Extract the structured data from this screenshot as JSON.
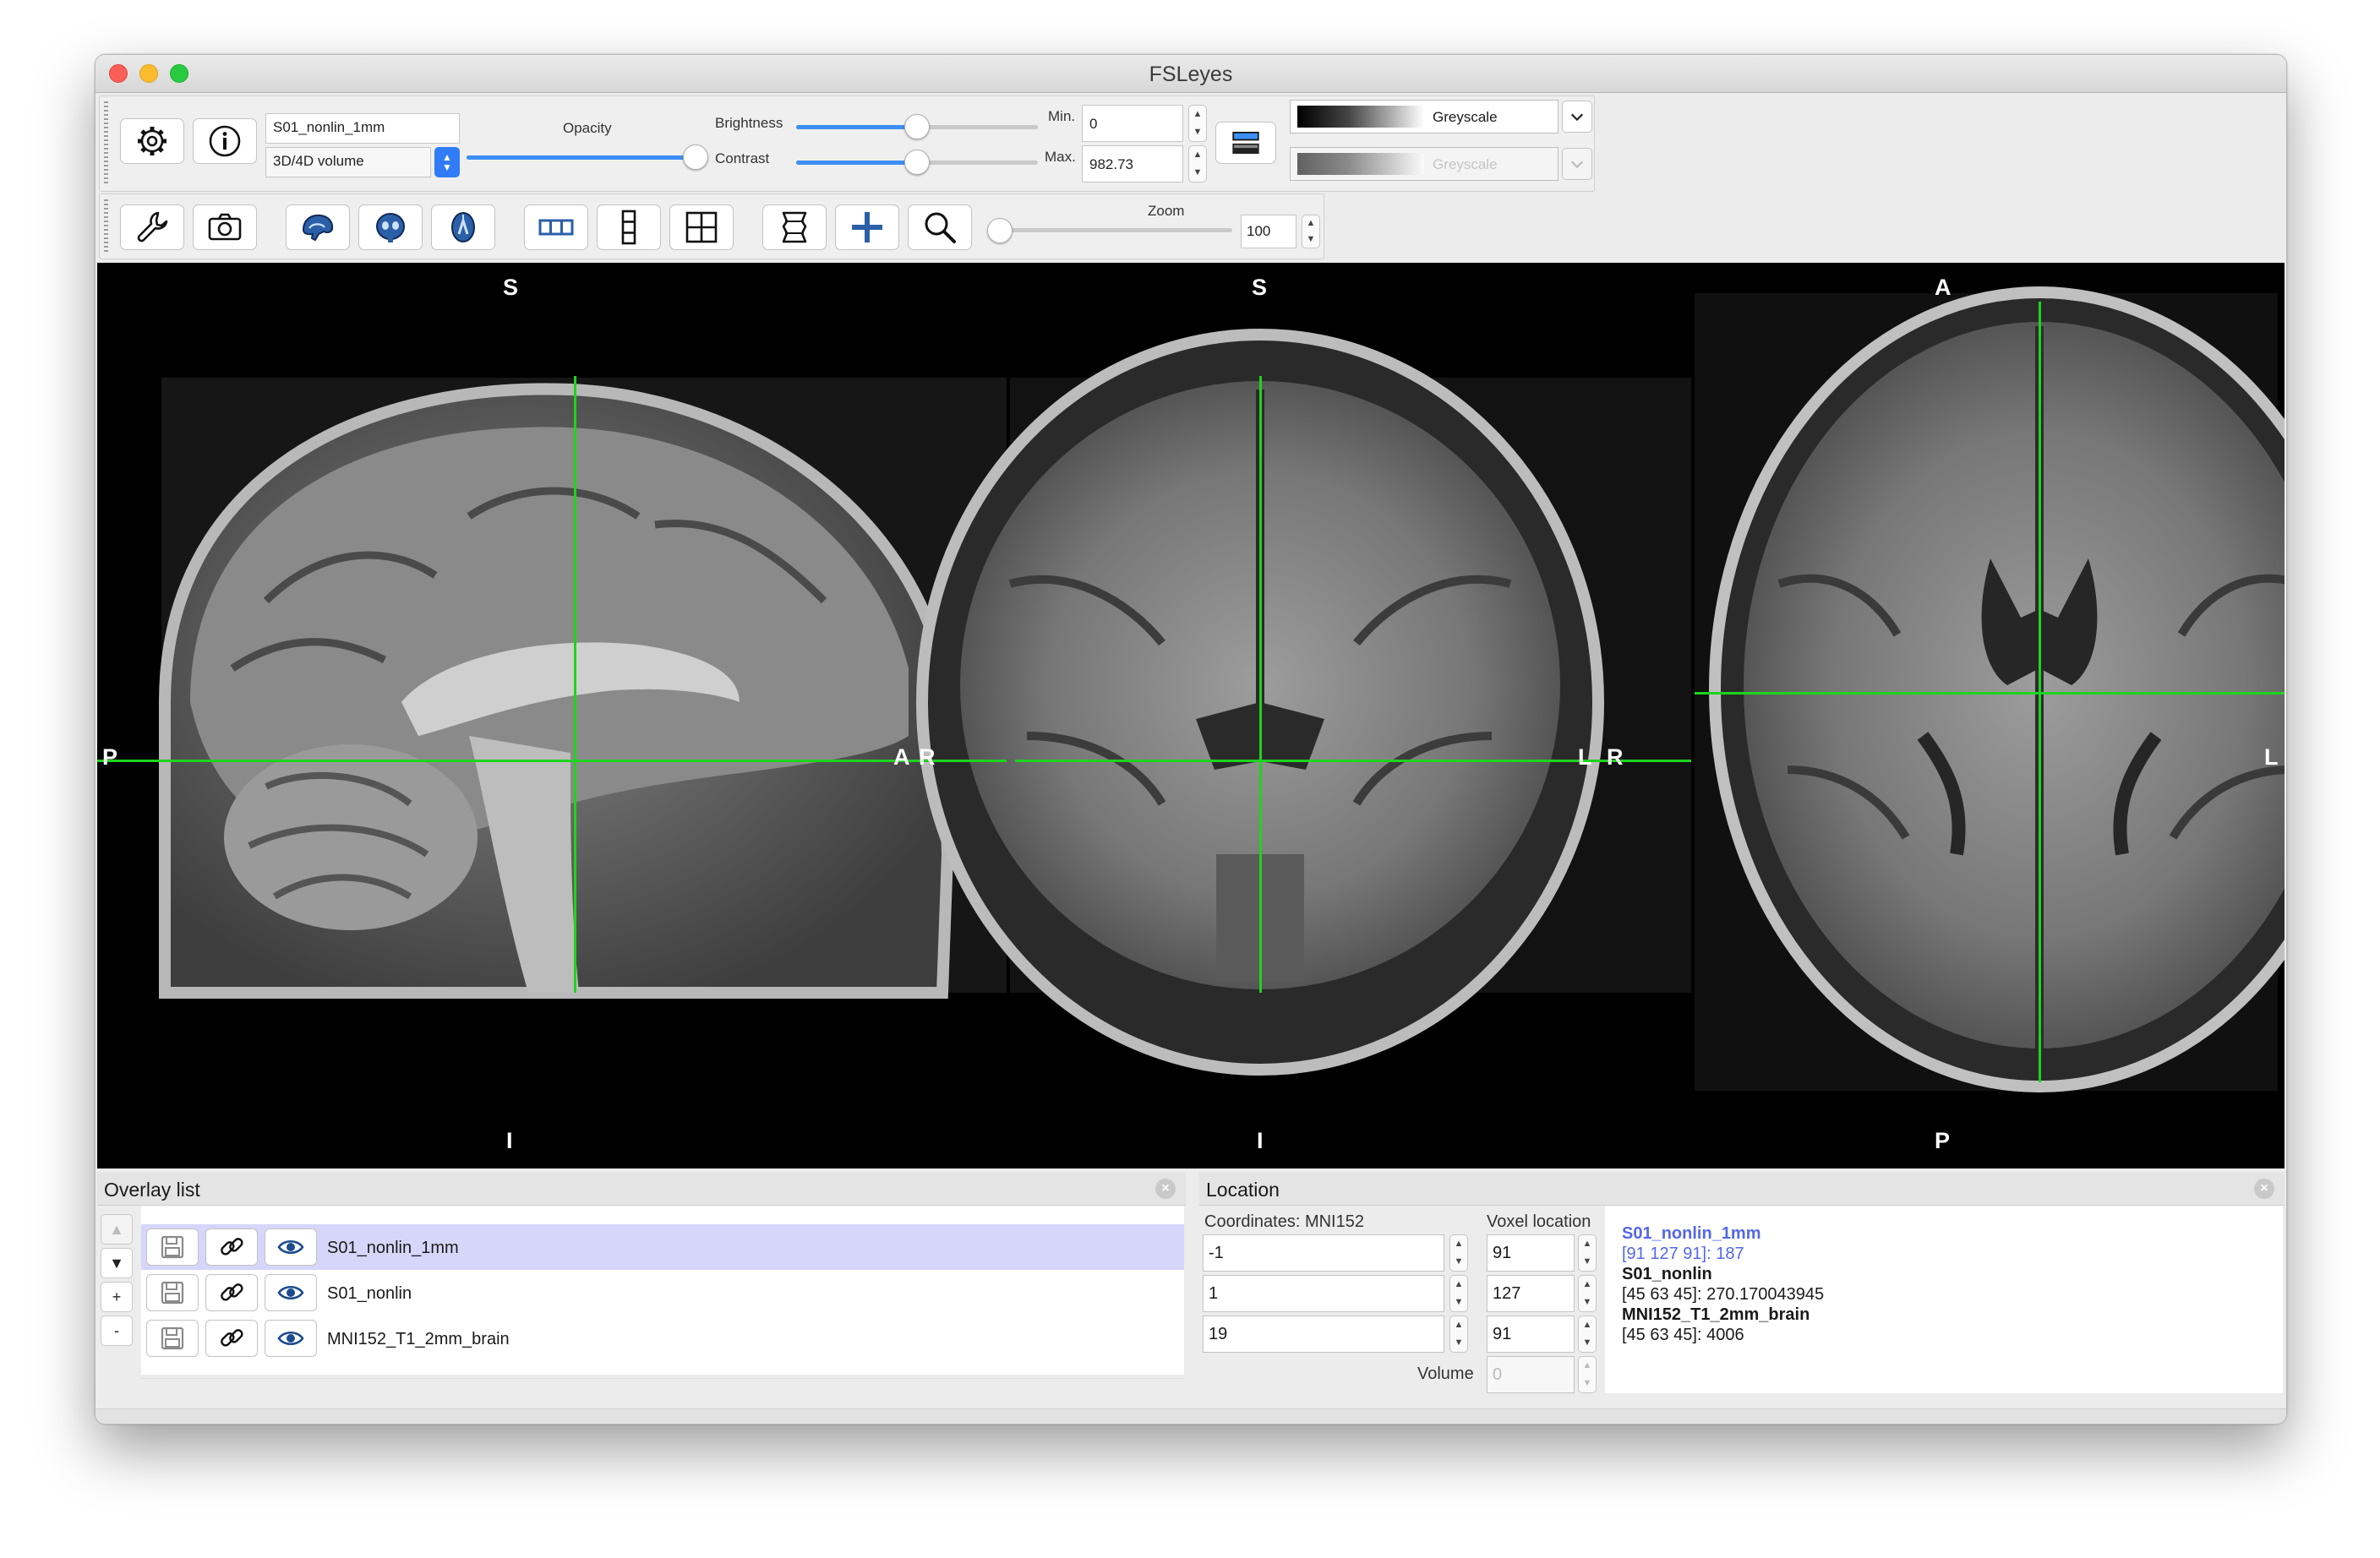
{
  "window": {
    "title": "FSLeyes"
  },
  "toolbar1": {
    "overlay_name": "S01_nonlin_1mm",
    "overlay_type": "3D/4D volume",
    "opacity_label": "Opacity",
    "opacity_value": 1.0,
    "brightness_label": "Brightness",
    "brightness_value": 0.5,
    "contrast_label": "Contrast",
    "contrast_value": 0.5,
    "min_label": "Min.",
    "min_value": "0",
    "max_label": "Max.",
    "max_value": "982.73",
    "cmap_primary": "Greyscale",
    "cmap_secondary": "Greyscale"
  },
  "toolbar2": {
    "zoom_label": "Zoom",
    "zoom_value": "100",
    "zoom_fraction": 0.0
  },
  "views": {
    "sagittal": {
      "top": "S",
      "bottom": "I",
      "left": "P",
      "right": "A"
    },
    "coronal": {
      "top": "S",
      "bottom": "I",
      "left": "R",
      "right": "L"
    },
    "axial": {
      "top": "A",
      "bottom": "P",
      "left": "R",
      "right": "L"
    }
  },
  "colors": {
    "cursor": "#1fd31f",
    "selection": "#d6d6fb",
    "link_blue": "#5468e8",
    "accent": "#3d8ef3"
  },
  "overlay_list": {
    "title": "Overlay list",
    "items": [
      {
        "name": "S01_nonlin_1mm",
        "selected": true
      },
      {
        "name": "S01_nonlin",
        "selected": false
      },
      {
        "name": "MNI152_T1_2mm_brain",
        "selected": false
      }
    ],
    "buttons": [
      "▲",
      "▼",
      "+",
      "-"
    ]
  },
  "location": {
    "title": "Location",
    "coords_label": "Coordinates: MNI152",
    "voxel_label": "Voxel location",
    "coords": [
      "-1",
      "1",
      "19"
    ],
    "voxels": [
      "91",
      "127",
      "91"
    ],
    "volume_label": "Volume",
    "volume_value": "0",
    "info": [
      {
        "text": "S01_nonlin_1mm",
        "style": "link-bold"
      },
      {
        "text": "[91 127 91]: 187",
        "style": "link"
      },
      {
        "text": "S01_nonlin",
        "style": "bold"
      },
      {
        "text": "[45 63 45]: 270.170043945",
        "style": "plain"
      },
      {
        "text": "MNI152_T1_2mm_brain",
        "style": "bold"
      },
      {
        "text": "[45 63 45]: 4006",
        "style": "plain"
      }
    ]
  }
}
